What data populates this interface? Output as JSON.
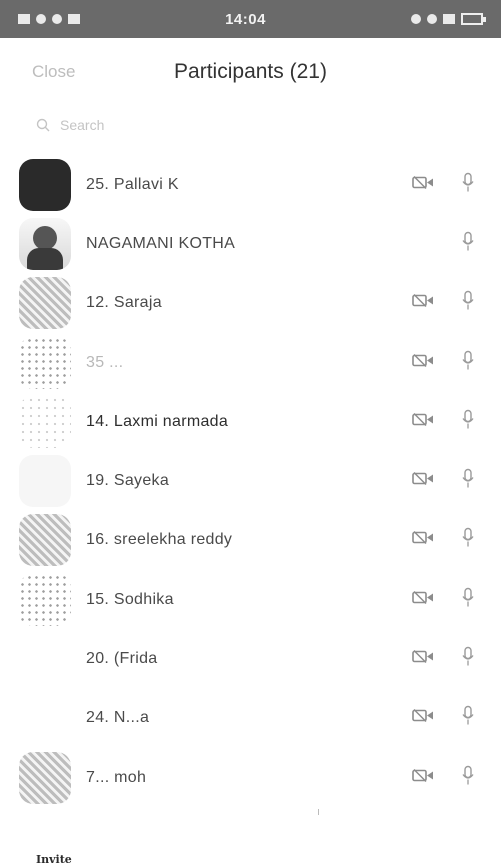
{
  "status_bar": {
    "time": "14:04"
  },
  "header": {
    "close_label": "Close",
    "title": "Participants (21)"
  },
  "search": {
    "placeholder": "Search"
  },
  "participants": [
    {
      "name": "25. Pallavi K",
      "avatar": "dark",
      "video": true,
      "mic": true
    },
    {
      "name": "NAGAMANI KOTHA",
      "avatar": "photo",
      "video": false,
      "mic": true
    },
    {
      "name": "12. Saraja",
      "avatar": "pattern",
      "video": true,
      "mic": true
    },
    {
      "name": "35 ...",
      "avatar": "dots",
      "video": true,
      "mic": true
    },
    {
      "name": "14. Laxmi narmada",
      "avatar": "light",
      "video": true,
      "mic": true
    },
    {
      "name": "19. Sayeka",
      "avatar": "faint",
      "video": true,
      "mic": true
    },
    {
      "name": "16. sreelekha reddy",
      "avatar": "pattern",
      "video": true,
      "mic": true
    },
    {
      "name": "15. Sodhika",
      "avatar": "dots",
      "video": true,
      "mic": true
    },
    {
      "name": "20. (Frida",
      "avatar": "none",
      "video": true,
      "mic": true
    },
    {
      "name": "24. N...a",
      "avatar": "none",
      "video": true,
      "mic": true
    },
    {
      "name": "7... moh",
      "avatar": "pattern",
      "video": true,
      "mic": true
    }
  ],
  "footer": {
    "invite_label": "Invite"
  },
  "icons": {
    "video": "video-camera-icon",
    "mic": "microphone-icon",
    "search": "search-icon"
  }
}
